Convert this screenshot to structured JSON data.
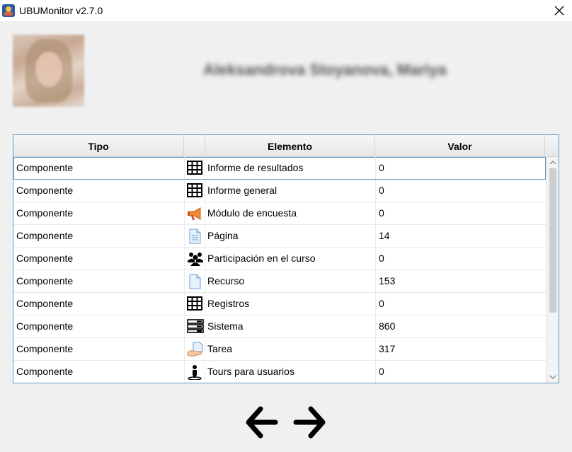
{
  "window": {
    "title": "UBUMonitor v2.7.0"
  },
  "user": {
    "name": "Aleksandrova Stoyanova, Mariya"
  },
  "table": {
    "headers": [
      "Tipo",
      "Elemento",
      "Valor"
    ],
    "rows": [
      {
        "tipo": "Componente",
        "icon": "table-icon",
        "elemento": "Informe de resultados",
        "valor": "0"
      },
      {
        "tipo": "Componente",
        "icon": "table-icon",
        "elemento": "Informe general",
        "valor": "0"
      },
      {
        "tipo": "Componente",
        "icon": "megaphone-icon",
        "elemento": "Módulo de encuesta",
        "valor": "0"
      },
      {
        "tipo": "Componente",
        "icon": "page-icon",
        "elemento": "Página",
        "valor": "14"
      },
      {
        "tipo": "Componente",
        "icon": "people-icon",
        "elemento": "Participación en el curso",
        "valor": "0"
      },
      {
        "tipo": "Componente",
        "icon": "document-icon",
        "elemento": "Recurso",
        "valor": "153"
      },
      {
        "tipo": "Componente",
        "icon": "table-icon",
        "elemento": "Registros",
        "valor": "0"
      },
      {
        "tipo": "Componente",
        "icon": "server-icon",
        "elemento": "Sistema",
        "valor": "860"
      },
      {
        "tipo": "Componente",
        "icon": "hand-paper-icon",
        "elemento": "Tarea",
        "valor": "317"
      },
      {
        "tipo": "Componente",
        "icon": "user-tour-icon",
        "elemento": "Tours para usuarios",
        "valor": "0"
      }
    ]
  },
  "colors": {
    "selection_border": "#5f9dcb",
    "background": "#f0f0f0"
  },
  "navigation": {
    "back_icon": "arrow-left-icon",
    "forward_icon": "arrow-right-icon"
  }
}
